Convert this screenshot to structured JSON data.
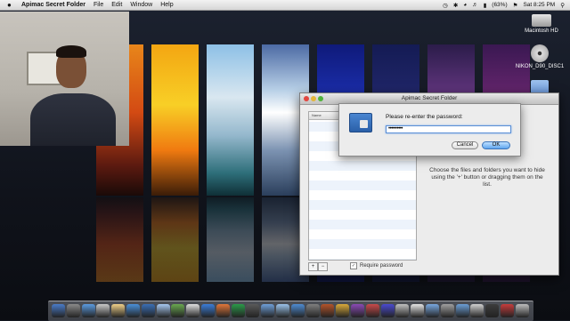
{
  "menubar": {
    "app_name": "Apimac Secret Folder",
    "items": [
      "File",
      "Edit",
      "Window",
      "Help"
    ],
    "battery": "(63%)",
    "clock": "Sat 8:25 PM"
  },
  "desktop_icons": [
    {
      "label": "Macintosh HD",
      "icon": "hard-drive-icon"
    },
    {
      "label": "NIKON_D90_DISC1",
      "icon": "dvd-icon"
    },
    {
      "label": "",
      "icon": "folder-icon"
    }
  ],
  "app_window": {
    "title": "Apimac Secret Folder",
    "list_header": "Name",
    "hint": "Choose the files and folders you want to hide using the '+' button or dragging them on the list.",
    "add_label": "+",
    "remove_label": "−",
    "require_password_label": "Require password",
    "require_password_checked": true
  },
  "sheet": {
    "prompt": "Please re-enter the password:",
    "password_value": "••••••••••",
    "cancel_label": "Cancel",
    "ok_label": "OK"
  },
  "dock": {
    "colors": [
      "#4a7cc9",
      "#8a8a8a",
      "#5b9be0",
      "#c9c9c9",
      "#f0d089",
      "#4a90d9",
      "#3a6fb5",
      "#a7c8f0",
      "#6aa84f",
      "#e0e0e0",
      "#3b7dd8",
      "#e2773a",
      "#2b9a49",
      "#5a5a5a",
      "#6f9fd8",
      "#9bc2ea",
      "#4e8bd2",
      "#7f7f7f",
      "#b4532a",
      "#d9aa3a",
      "#8a4ab5",
      "#c94a4a",
      "#4a4ad0",
      "#c0c0c0",
      "#e5e5e5",
      "#79a9e0",
      "#a0a0a0",
      "#6c9fd6",
      "#d0d0d0",
      "#3d3d3d",
      "#c63c3c",
      "#bdbdbd"
    ]
  }
}
